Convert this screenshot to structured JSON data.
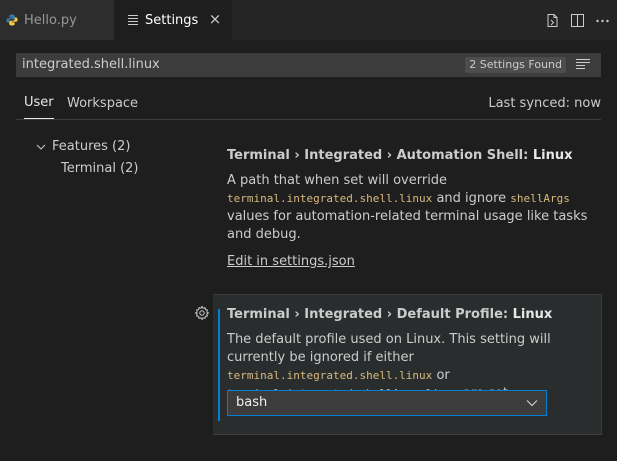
{
  "tabs": [
    {
      "label": "Hello.py",
      "icon": "python-file-icon",
      "active": false
    },
    {
      "label": "Settings",
      "icon": "settings-file-icon",
      "active": true
    }
  ],
  "editor_actions": [
    "open-settings-json-icon",
    "split-editor-icon",
    "more-actions-icon"
  ],
  "search": {
    "value": "integrated.shell.linux",
    "results_badge": "2 Settings Found"
  },
  "scope": {
    "user_label": "User",
    "workspace_label": "Workspace",
    "last_synced": "Last synced: now"
  },
  "toc": {
    "features_label": "Features (2)",
    "terminal_label": "Terminal (2)"
  },
  "setting1": {
    "breadcrumb": "Terminal › Integrated › Automation Shell: ",
    "key": "Linux",
    "desc_a": "A path that when set will override",
    "code_a": "terminal.integrated.shell.linux",
    "desc_b": " and ignore ",
    "code_b": "shellArgs",
    "desc_c": "values for automation-related terminal usage like tasks and debug.",
    "link": "Edit in settings.json"
  },
  "setting2": {
    "breadcrumb": "Terminal › Integrated › Default Profile: ",
    "key": "Linux",
    "desc_a": "The default profile used on Linux. This setting will currently be ignored if either ",
    "code_a": "terminal.integrated.shell.linux",
    "desc_b": " or ",
    "code_b": "terminal.integrated.shellArgs.linux",
    "desc_c": " are set.",
    "value": "bash"
  },
  "colors": {
    "accent": "#007fd4",
    "code": "#d7ba7d",
    "background": "#1e1e1e"
  }
}
